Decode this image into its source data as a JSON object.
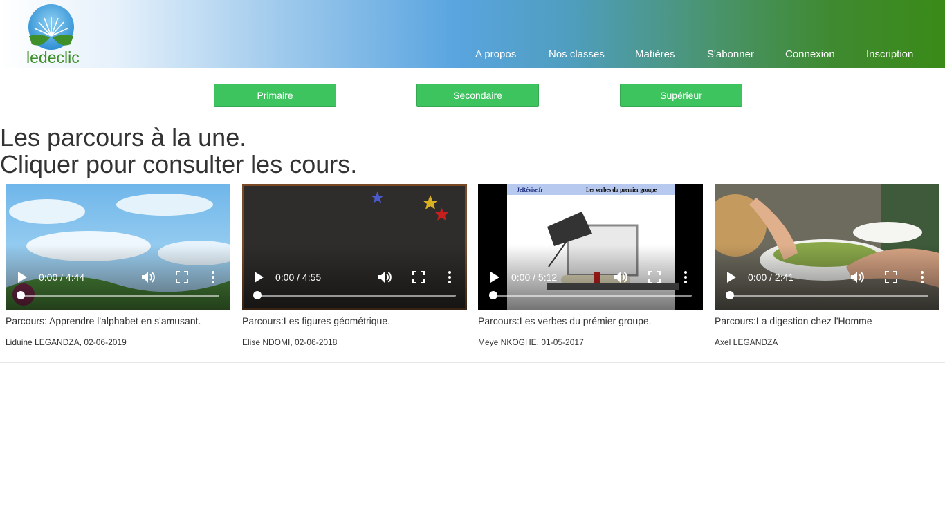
{
  "brand": {
    "name": "ledeclic"
  },
  "nav": [
    {
      "label": "A propos"
    },
    {
      "label": "Nos classes"
    },
    {
      "label": "Matières"
    },
    {
      "label": "S'abonner"
    },
    {
      "label": "Connexion"
    },
    {
      "label": "Inscription"
    }
  ],
  "levels": [
    {
      "label": "Primaire"
    },
    {
      "label": "Secondaire"
    },
    {
      "label": "Supérieur"
    }
  ],
  "headline": {
    "line1": "Les parcours à la une.",
    "line2": "Cliquer pour consulter les cours."
  },
  "courses": [
    {
      "time": "0:00 / 4:44",
      "title": "Parcours: Apprendre l'alphabet en s'amusant.",
      "author": "Liduine LEGANDZA, 02-06-2019",
      "progress": 0
    },
    {
      "time": "0:00 / 4:55",
      "title": "Parcours:Les figures géométrique.",
      "author": "Elise NDOMI, 02-06-2018",
      "progress": 0
    },
    {
      "time": "0:00 / 5:12",
      "title": "Parcours:Les verbes du prémier groupe.",
      "author": "Meye NKOGHE, 01-05-2017",
      "progress": 0,
      "thumb_text": {
        "site": "JeRévise.fr",
        "topic": "Les verbes du premier groupe"
      }
    },
    {
      "time": "0:00 / 2:41",
      "title": "Parcours:La digestion chez l'Homme",
      "author": "Axel LEGANDZA",
      "progress": 0
    }
  ],
  "colors": {
    "button_green": "#3ec45f",
    "logo_green": "#3f8f2a",
    "header_blue": "#5aa5e0",
    "header_green": "#3a8a18"
  }
}
